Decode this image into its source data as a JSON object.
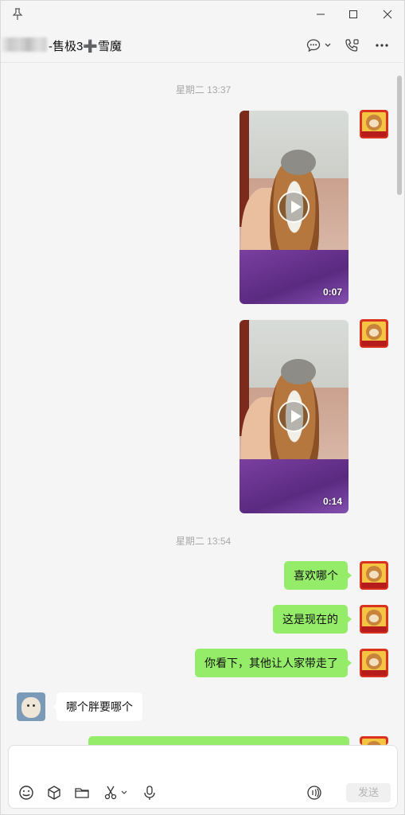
{
  "header": {
    "chat_title": "-售极3➕雪魔"
  },
  "messages": {
    "ts1": "星期二 13:37",
    "video1_duration": "0:07",
    "video2_duration": "0:14",
    "ts2": "星期二 13:54",
    "msg1": "喜欢哪个",
    "msg2": "这是现在的",
    "msg3": "你看下，其他让人家带走了",
    "msg4": "哪个胖要哪个"
  },
  "input": {
    "send_label": "发送"
  },
  "colors": {
    "my_bubble": "#95ec69",
    "other_bubble": "#ffffff",
    "background": "#f5f5f5"
  },
  "icons": [
    "pin-icon",
    "minimize-icon",
    "maximize-icon",
    "close-icon",
    "chat-bubble-icon",
    "chevron-down-icon",
    "video-call-icon",
    "more-icon",
    "emoji-icon",
    "sticker-icon",
    "folder-icon",
    "scissors-icon",
    "microphone-icon",
    "voice-call-icon",
    "play-icon"
  ]
}
